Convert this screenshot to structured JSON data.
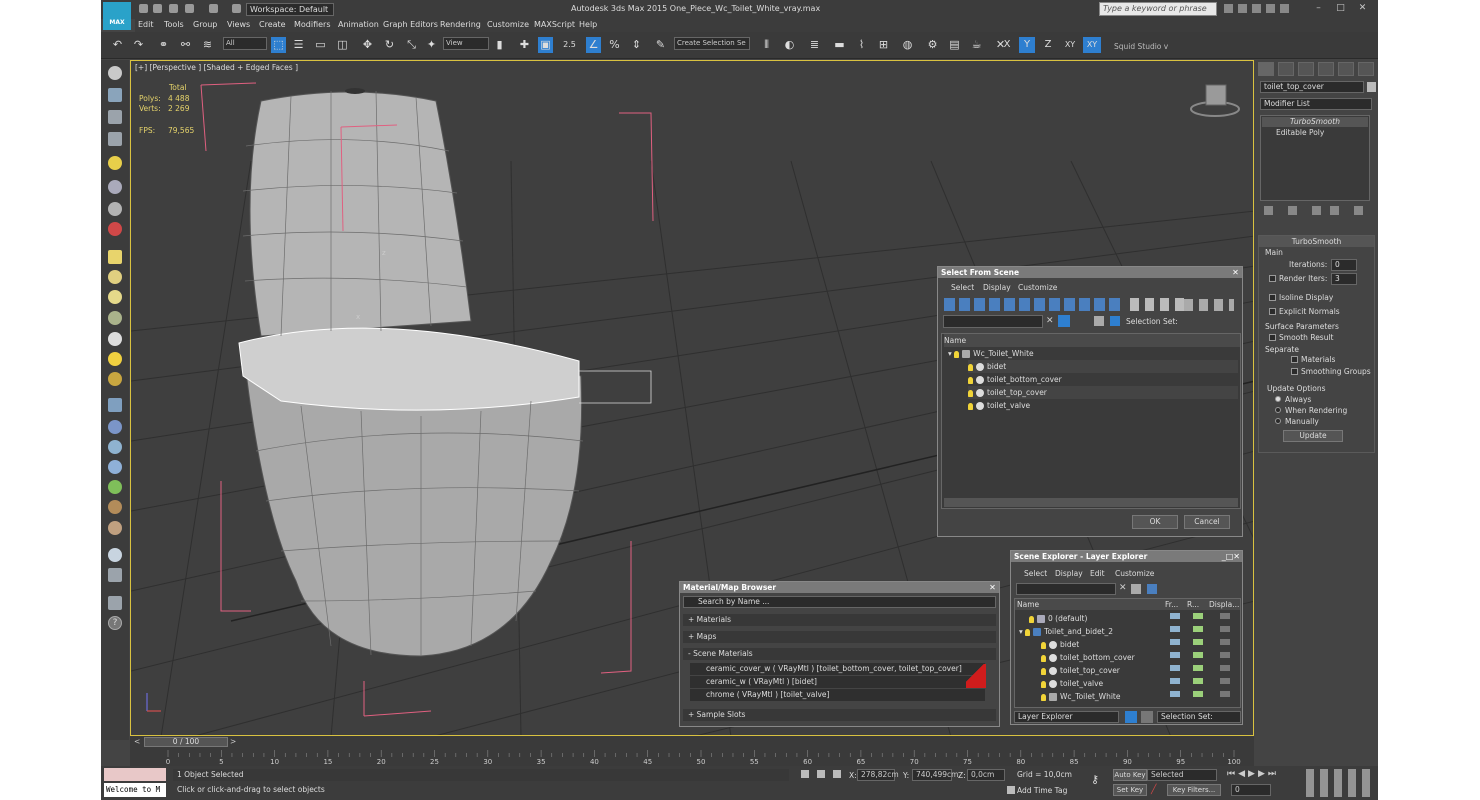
{
  "app": {
    "logo_text": "MAX",
    "workspace": "Workspace: Default",
    "title": "Autodesk 3ds Max  2015     One_Piece_Wc_Toilet_White_vray.max",
    "search_placeholder": "Type a keyword or phrase"
  },
  "menu": [
    "Edit",
    "Tools",
    "Group",
    "Views",
    "Create",
    "Modifiers",
    "Animation",
    "Graph Editors",
    "Rendering",
    "Customize",
    "MAXScript",
    "Help"
  ],
  "toolbar": {
    "filter": "All",
    "ref_coord": "View",
    "snap_value": "2.5",
    "selection_set": "Create Selection Se",
    "axes": [
      "X",
      "Y",
      "Z",
      "XY",
      "XY"
    ],
    "studio": "Squid Studio v"
  },
  "viewport": {
    "label": "[+] [Perspective ] [Shaded + Edged Faces ]",
    "stats": {
      "total": "Total",
      "polys_label": "Polys:",
      "polys": "4 488",
      "verts_label": "Verts:",
      "verts": "2 269",
      "fps_label": "FPS:",
      "fps": "79,565"
    },
    "axis_labels": [
      "z",
      "x"
    ]
  },
  "command_panel": {
    "object_name": "toilet_top_cover",
    "modifier_list": "Modifier List",
    "stack": [
      "TurboSmooth",
      "Editable Poly"
    ],
    "rollout_title": "TurboSmooth",
    "main": "Main",
    "iterations_label": "Iterations:",
    "iterations": "0",
    "render_iters_label": "Render Iters:",
    "render_iters": "3",
    "isoline": "Isoline Display",
    "explicit": "Explicit Normals",
    "surface_params": "Surface Parameters",
    "smooth_result": "Smooth Result",
    "separate": "Separate",
    "materials": "Materials",
    "smoothing_groups": "Smoothing Groups",
    "update_options": "Update Options",
    "always": "Always",
    "when_rendering": "When Rendering",
    "manually": "Manually",
    "update": "Update"
  },
  "select_dialog": {
    "title": "Select From Scene",
    "menus": [
      "Select",
      "Display",
      "Customize"
    ],
    "selection_set": "Selection Set:",
    "column": "Name",
    "root": "Wc_Toilet_White",
    "items": [
      "bidet",
      "toilet_bottom_cover",
      "toilet_top_cover",
      "toilet_valve"
    ],
    "ok": "OK",
    "cancel": "Cancel"
  },
  "material_browser": {
    "title": "Material/Map Browser",
    "search": "Search by Name ...",
    "materials": "+ Materials",
    "maps": "+ Maps",
    "scene_materials": "- Scene Materials",
    "entries": [
      "ceramic_cover_w  ( VRayMtl ) [toilet_bottom_cover, toilet_top_cover]",
      "ceramic_w  ( VRayMtl ) [bidet]",
      "chrome  ( VRayMtl ) [toilet_valve]"
    ],
    "sample_slots": "+ Sample Slots"
  },
  "scene_explorer": {
    "title": "Scene Explorer - Layer Explorer",
    "menus": [
      "Select",
      "Display",
      "Edit",
      "Customize"
    ],
    "columns": [
      "Name",
      "Fr...",
      "R...",
      "Displa..."
    ],
    "rows": [
      {
        "name": "0 (default)",
        "indent": 0
      },
      {
        "name": "Toilet_and_bidet_2",
        "indent": 0
      },
      {
        "name": "bidet",
        "indent": 1
      },
      {
        "name": "toilet_bottom_cover",
        "indent": 1
      },
      {
        "name": "toilet_top_cover",
        "indent": 1
      },
      {
        "name": "toilet_valve",
        "indent": 1
      },
      {
        "name": "Wc_Toilet_White",
        "indent": 1
      }
    ],
    "footer_mode": "Layer Explorer",
    "footer_set": "Selection Set:"
  },
  "timeline": {
    "frame": "0 / 100",
    "ticks": [
      "0",
      "5",
      "10",
      "15",
      "20",
      "25",
      "30",
      "35",
      "40",
      "45",
      "50",
      "55",
      "60",
      "65",
      "70",
      "75",
      "80",
      "85",
      "90",
      "95",
      "100"
    ]
  },
  "status": {
    "listener": "Welcome to M",
    "selected": "1 Object Selected",
    "prompt": "Click or click-and-drag to select objects",
    "x_label": "X:",
    "x": "278,82cm",
    "y_label": "Y:",
    "y": "740,499cm",
    "z_label": "Z:",
    "z": "0,0cm",
    "grid": "Grid = 10,0cm",
    "add_time_tag": "Add Time Tag",
    "auto_key": "Auto Key",
    "set_key": "Set Key",
    "key_mode": "Selected",
    "key_filters": "Key Filters...",
    "frame_field": "0"
  },
  "colors": {
    "viewport_border": "#d9c240",
    "stats": "#e5d36b",
    "selection_box": "#e06080",
    "axis_active": "#2e7fd0",
    "accent": "#2aa2c9",
    "material_swatch": "#d01c1c"
  }
}
